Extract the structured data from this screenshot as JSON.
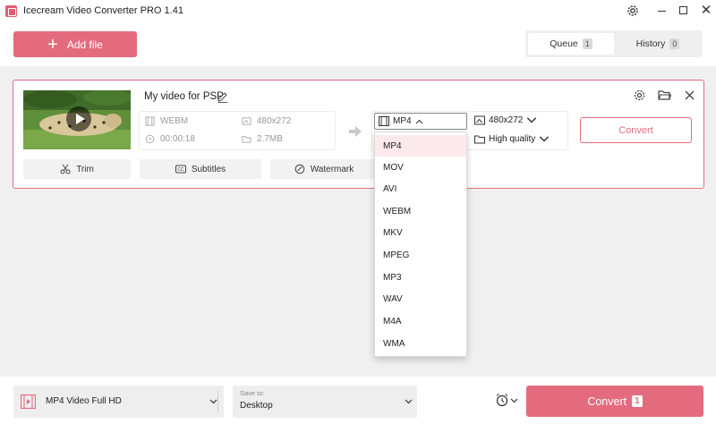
{
  "window": {
    "title": "Icecream Video Converter PRO 1.41",
    "controls": {
      "minimize": "—",
      "maximize": "☐",
      "close": "✕"
    }
  },
  "toolbar": {
    "add_file_label": "Add file",
    "tabs": [
      {
        "label": "Queue",
        "count": "1",
        "active": true
      },
      {
        "label": "History",
        "count": "0",
        "active": false
      }
    ]
  },
  "video_item": {
    "name": "My video for PSP",
    "source": {
      "format": "WEBM",
      "resolution": "480x272",
      "duration": "00:00:18",
      "size": "2.7MB"
    },
    "output": {
      "format": "MP4",
      "resolution": "480x272",
      "quality": "High quality"
    },
    "convert_label": "Convert",
    "tools": [
      {
        "label": "Trim"
      },
      {
        "label": "Subtitles"
      },
      {
        "label": "Watermark"
      }
    ]
  },
  "format_dropdown": {
    "options": [
      "MP4",
      "MOV",
      "AVI",
      "WEBM",
      "MKV",
      "MPEG",
      "MP3",
      "WAV",
      "M4A",
      "WMA"
    ],
    "selected": "MP4"
  },
  "bottom": {
    "preset": "MP4 Video Full HD",
    "save_to_caption": "Save to:",
    "save_to_value": "Desktop",
    "convert_label": "Convert",
    "convert_count": "1"
  },
  "colors": {
    "accent": "#e36b7d",
    "selected_bg": "#fce9ec"
  }
}
